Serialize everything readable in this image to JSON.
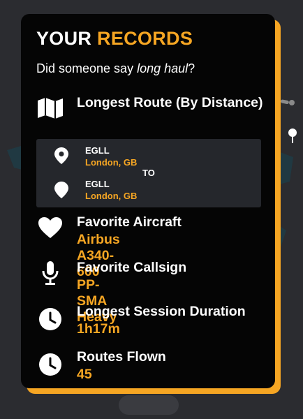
{
  "title": {
    "part1": "YOUR",
    "part2": "RECORDS"
  },
  "subtitle": {
    "prefix": "Did someone say ",
    "emphasis": "long haul",
    "suffix": "?"
  },
  "longest_route": {
    "label": "Longest Route (By Distance)",
    "icon": "map-icon",
    "origin": {
      "code": "EGLL",
      "city": "London, GB"
    },
    "connector": "TO",
    "destination": {
      "code": "EGLL",
      "city": "London, GB"
    }
  },
  "favorite_aircraft": {
    "label": "Favorite Aircraft",
    "value": "Airbus A340-600",
    "icon": "heart-icon"
  },
  "favorite_callsign": {
    "label": "Favorite Callsign",
    "value": "PP-SMA Heavy",
    "icon": "microphone-icon"
  },
  "longest_session": {
    "label": "Longest Session Duration",
    "value": "1h17m",
    "icon": "clock-icon"
  },
  "routes_flown": {
    "label": "Routes Flown",
    "value": "45",
    "icon": "clock-icon"
  },
  "colors": {
    "accent": "#f6a623",
    "card": "#050505",
    "route_box": "#25272c",
    "background": "#2b2c30"
  }
}
